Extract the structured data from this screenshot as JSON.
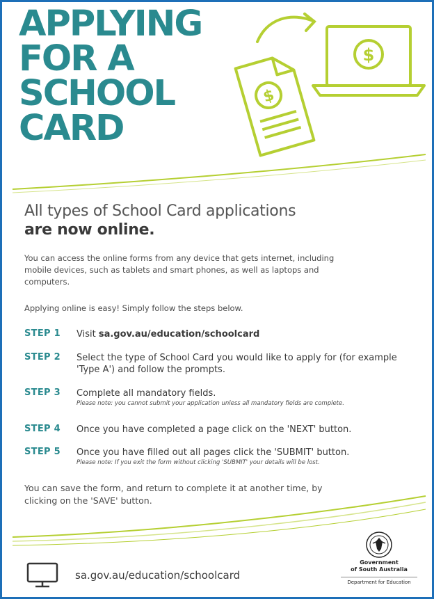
{
  "title_lines": [
    "APPLYING",
    "FOR A",
    "SCHOOL",
    "CARD"
  ],
  "subtitle": {
    "line1": "All types of School Card applications",
    "line2": "are now online."
  },
  "intro": "You can access the online forms from any device that gets internet, including mobile devices, such as tablets and smart phones, as well as laptops and computers.",
  "easy_text": "Applying online is easy! Simply follow the steps below.",
  "steps": [
    {
      "label": "STEP 1",
      "text": "Visit ",
      "bold": "sa.gov.au/education/schoolcard",
      "note": ""
    },
    {
      "label": "STEP 2",
      "text": "Select the type of School Card you would like to apply for (for example 'Type A') and follow the prompts.",
      "bold": "",
      "note": ""
    },
    {
      "label": "STEP 3",
      "text": "Complete all mandatory fields.",
      "bold": "",
      "note": "Please note: you cannot submit your application unless all mandatory fields are complete."
    },
    {
      "label": "STEP 4",
      "text": "Once you have completed a page click on the 'NEXT' button.",
      "bold": "",
      "note": ""
    },
    {
      "label": "STEP 5",
      "text": "Once you have filled out all pages click the 'SUBMIT' button.",
      "bold": "",
      "note": "Please note: If you exit the form without clicking 'SUBMIT' your details will be lost."
    }
  ],
  "save_text": "You can save the form, and return to complete it at another time, by clicking on the 'SAVE' button.",
  "footer": {
    "url": "sa.gov.au/education/schoolcard",
    "icon": "monitor-icon",
    "govt_line1": "Government",
    "govt_line2": "of South Australia",
    "dept": "Department for Education",
    "crest_text": "SOUTH AUSTRALIA"
  },
  "colors": {
    "frame": "#1d6fb8",
    "title": "#2a8a8f",
    "accent": "#b5cf32"
  }
}
